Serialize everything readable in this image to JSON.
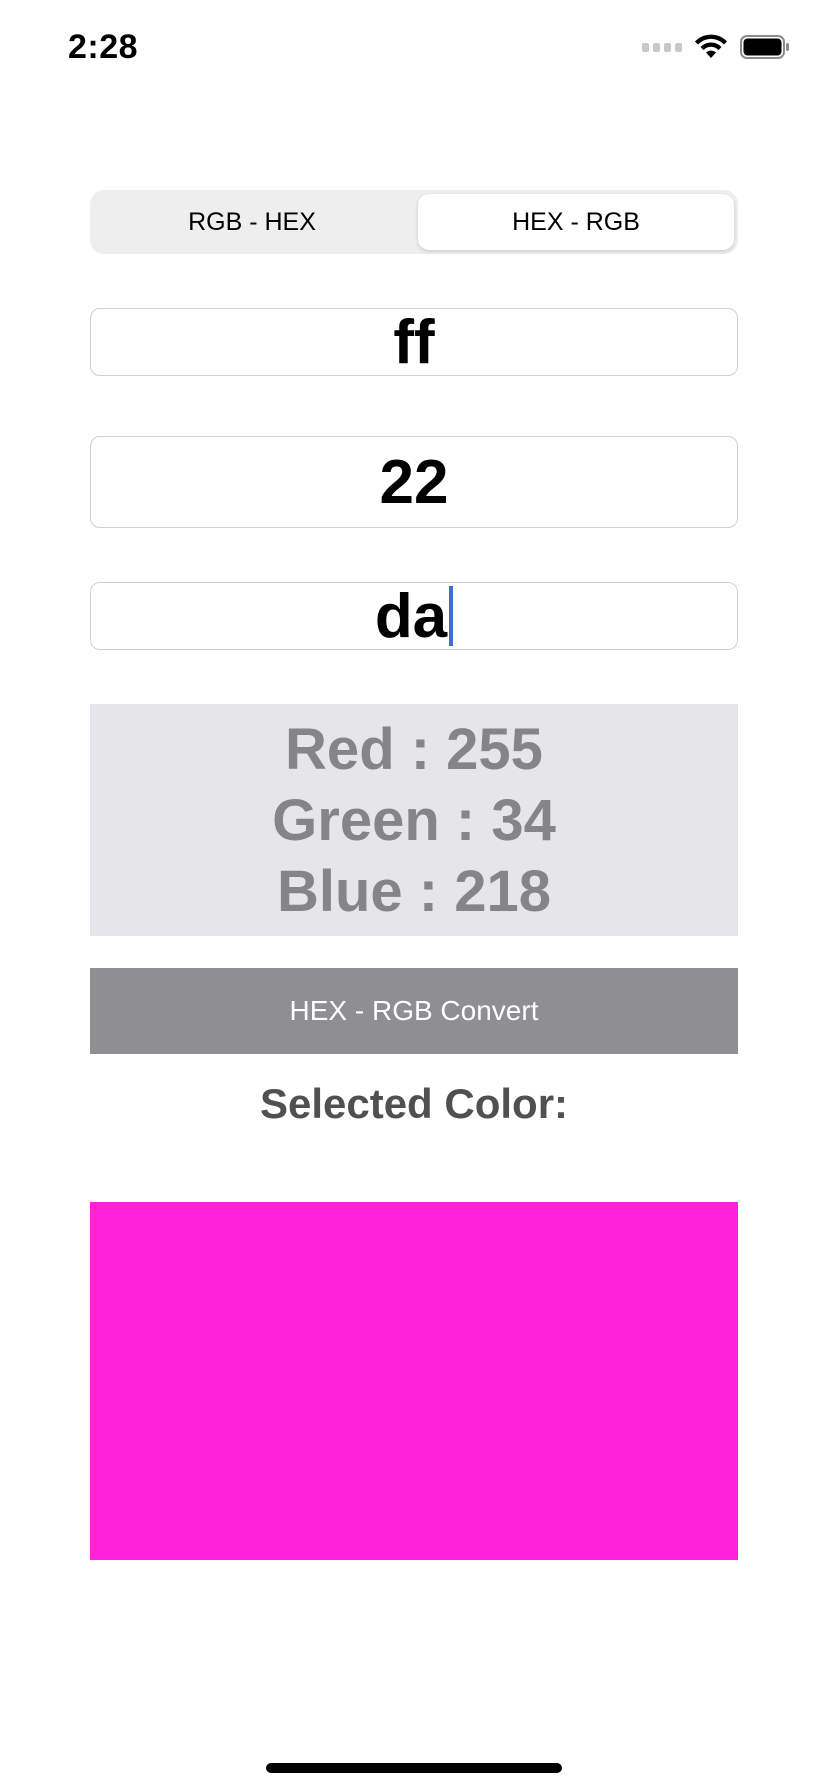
{
  "status_bar": {
    "time": "2:28"
  },
  "segmented_control": {
    "options": [
      "RGB - HEX",
      "HEX - RGB"
    ],
    "selected": "HEX - RGB"
  },
  "inputs": {
    "red_hex": "ff",
    "green_hex": "22",
    "blue_hex": "da"
  },
  "result": {
    "red_line": "Red : 255",
    "green_line": "Green : 34",
    "blue_line": "Blue : 218"
  },
  "convert_button": {
    "label": "HEX - RGB Convert"
  },
  "selected_color": {
    "label": "Selected Color:",
    "swatch_color": "#ff22da"
  },
  "colors": {
    "caret": "#3a6fd8",
    "button_bg": "#8e8e93",
    "result_bg": "#e5e5ea"
  },
  "icons": {
    "cellular": "cellular-signal-icon",
    "wifi": "wifi-icon",
    "battery": "battery-icon"
  }
}
